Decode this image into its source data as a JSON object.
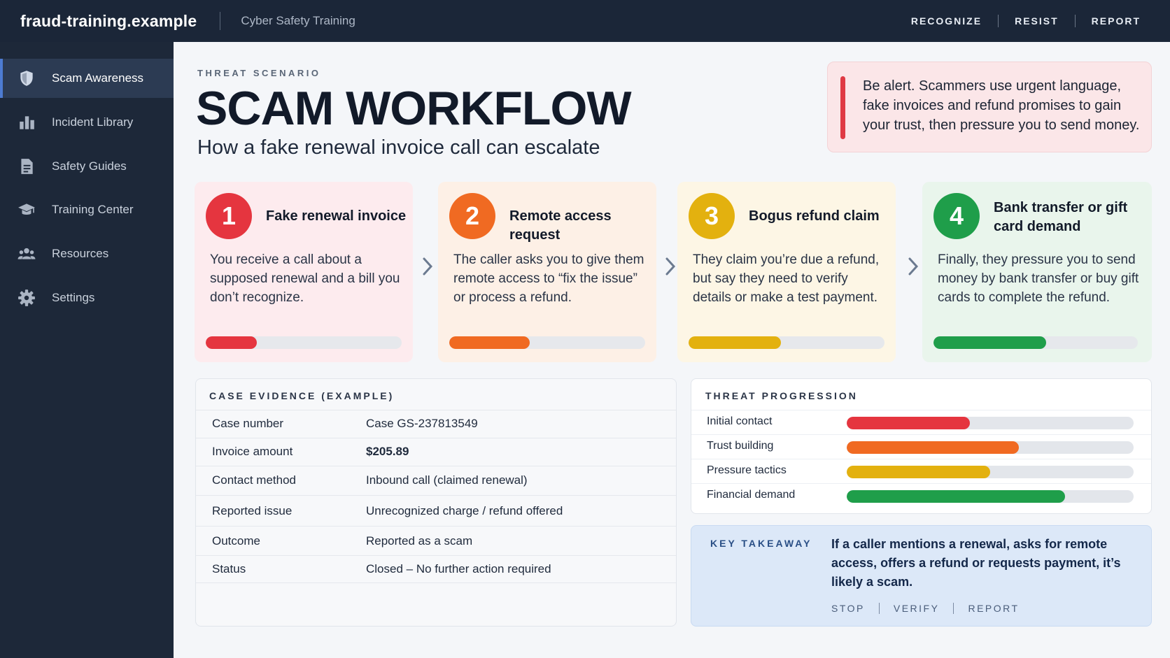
{
  "header": {
    "site_name": "fraud-training.example",
    "subtitle": "Cyber Safety Training",
    "nav": [
      "RECOGNIZE",
      "RESIST",
      "REPORT"
    ]
  },
  "sidebar": {
    "items": [
      {
        "label": "Scam Awareness",
        "icon": "shield-icon",
        "active": true
      },
      {
        "label": "Incident Library",
        "icon": "bar-chart-icon",
        "active": false
      },
      {
        "label": "Safety Guides",
        "icon": "document-icon",
        "active": false
      },
      {
        "label": "Training Center",
        "icon": "graduation-cap-icon",
        "active": false
      },
      {
        "label": "Resources",
        "icon": "people-icon",
        "active": false
      },
      {
        "label": "Settings",
        "icon": "gear-icon",
        "active": false
      }
    ]
  },
  "main": {
    "eyebrow": "THREAT SCENARIO",
    "title": "SCAM WORKFLOW",
    "subtitle": "How a fake renewal invoice call can escalate",
    "alert": "Be alert. Scammers use urgent language, fake invoices and refund promises to gain your trust, then pressure you to send money."
  },
  "steps": [
    {
      "number": "1",
      "title": "Fake renewal invoice",
      "text": "You receive a call about a supposed renewal and a bill you don’t recognize.",
      "progress": 0.26,
      "color": "#e5353f",
      "bg": "#fdebee"
    },
    {
      "number": "2",
      "title": "Remote access request",
      "text": "The caller asks you to give them remote access to “fix the issue” or process a refund.",
      "progress": 0.41,
      "color": "#f06a22",
      "bg": "#fdf0e6"
    },
    {
      "number": "3",
      "title": "Bogus refund claim",
      "text": "They claim you’re due a refund, but say they need to verify details or make a test payment.",
      "progress": 0.47,
      "color": "#e3b10f",
      "bg": "#fdf6e5"
    },
    {
      "number": "4",
      "title": "Bank transfer or gift card demand",
      "text": "Finally, they pressure you to send money by bank transfer or buy gift cards to complete the refund.",
      "progress": 0.55,
      "color": "#1f9e4a",
      "bg": "#e9f5ec"
    }
  ],
  "evidence": {
    "heading": "CASE EVIDENCE (EXAMPLE)",
    "rows": [
      {
        "label": "Case number",
        "value": "Case GS-237813549"
      },
      {
        "label": "Invoice amount",
        "value": "$205.89"
      },
      {
        "label": "Contact method",
        "value": "Inbound call (claimed renewal)"
      },
      {
        "label": "Reported issue",
        "value": "Unrecognized charge / refund offered"
      },
      {
        "label": "Outcome",
        "value": "Reported as a scam"
      },
      {
        "label": "Status",
        "value": "Closed – No further action required"
      }
    ]
  },
  "progression": {
    "heading": "THREAT PROGRESSION",
    "rows": [
      {
        "label": "Initial contact",
        "value": 0.43,
        "color": "#e5353f"
      },
      {
        "label": "Trust building",
        "value": 0.6,
        "color": "#f06a22"
      },
      {
        "label": "Pressure tactics",
        "value": 0.5,
        "color": "#e3b10f"
      },
      {
        "label": "Financial demand",
        "value": 0.76,
        "color": "#1f9e4a"
      }
    ]
  },
  "takeaway": {
    "heading": "KEY TAKEAWAY",
    "text": "If a caller mentions a renewal, asks for remote access, offers a refund or requests payment, it’s likely a scam.",
    "actions": [
      "STOP",
      "VERIFY",
      "REPORT"
    ]
  }
}
